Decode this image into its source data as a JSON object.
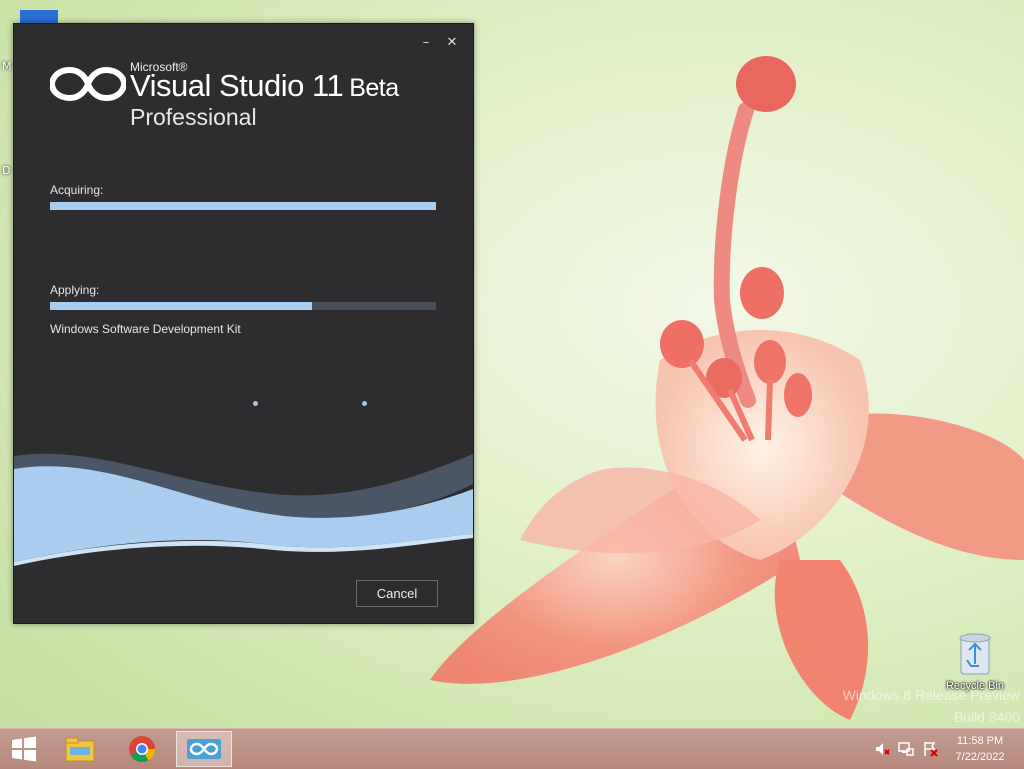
{
  "installer": {
    "logo": {
      "brand": "Microsoft®",
      "product": "Visual Studio",
      "version": "11",
      "stage": "Beta",
      "edition": "Professional"
    },
    "acquiring": {
      "label": "Acquiring:",
      "progress": 1.0
    },
    "applying": {
      "label": "Applying:",
      "progress": 0.68
    },
    "current_item": "Windows Software Development Kit",
    "cancel_label": "Cancel",
    "controls": {
      "minimize_icon": "minimize-icon",
      "close_icon": "close-icon"
    }
  },
  "desktop": {
    "recycle_bin_label": "Recycle Bin",
    "watermark_line1": "Windows 8 Release Preview",
    "watermark_line2": "Build 8400",
    "left_stub_1": "M",
    "left_stub_2": "D"
  },
  "taskbar": {
    "start_icon": "windows-start-icon",
    "pinned": [
      "file-explorer-icon",
      "chrome-icon",
      "visual-studio-installer-icon"
    ],
    "tray": [
      "volume-muted-icon",
      "network-icon",
      "action-center-icon"
    ],
    "time": "11:58 PM",
    "date": "7/22/2022"
  },
  "colors": {
    "installer_bg": "#2d2d30",
    "progress_fill": "#a7cdf0",
    "progress_track": "#4a4f57",
    "taskbar": "#b7897d"
  }
}
